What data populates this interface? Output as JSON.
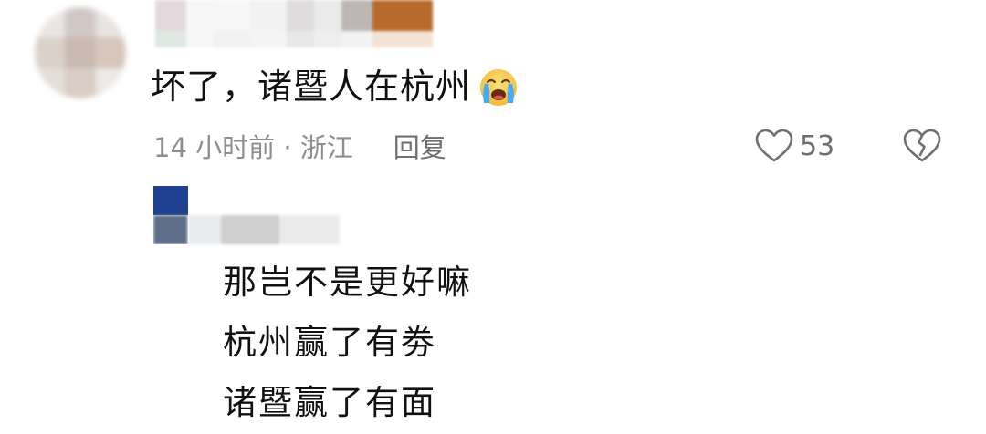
{
  "comment": {
    "text": "坏了，诸暨人在杭州",
    "emoji_icon": "loudly-crying-face-icon",
    "time_location": "14 小时前 · 浙江",
    "reply_label": "回复",
    "like_icon": "heart-outline-icon",
    "like_count": "53",
    "dislike_icon": "broken-heart-icon"
  },
  "reply": {
    "lines": [
      "那岂不是更好嘛",
      "杭州赢了有劵",
      "诸暨赢了有面"
    ]
  },
  "colors": {
    "text": "#111111",
    "meta": "#8e8e8e",
    "icon": "#6f6f6f",
    "background": "#ffffff"
  }
}
